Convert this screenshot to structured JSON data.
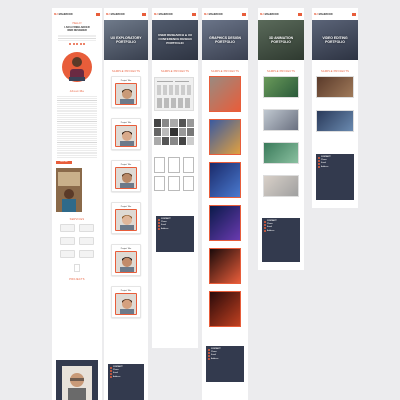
{
  "brand": {
    "logo_prefix": "MJ",
    "logo_text": "MAHMOOD",
    "accent": "#e85d3a",
    "dark": "#333a4e"
  },
  "profile": {
    "line1": "HELLO!",
    "line2": "I AM A FREELANCER",
    "line3": "WEB DESIGNER",
    "about_title": "About Me",
    "hire_label": "HIRE ME",
    "services_title": "SERVICES",
    "projects_title": "PROJECTS",
    "contact_title": "CONTACT ME",
    "contact_lines": [
      "CONTACT ME",
      "mahmood@mail.com",
      "+880 123 456 789",
      "Dhaka, Bangladesh"
    ]
  },
  "columns": [
    {
      "title": "UX EXPLORATORY PORTFOLIO",
      "section": "SAMPLE PROJECTS"
    },
    {
      "title": "USER RESEARCH & UX CONFERENCE DESIGN PORTFOLIO",
      "section": "SAMPLE PROJECTS"
    },
    {
      "title": "GRAPHICS DESIGN PORTFOLIO",
      "section": "SAMPLE PROJECTS"
    },
    {
      "title": "3D ANIMATION PORTFOLIO",
      "section": "SAMPLE PROJECTS"
    },
    {
      "title": "VIDEO EDITING PORTFOLIO",
      "section": "SAMPLE PROJECTS"
    }
  ],
  "card_caption": "Project Title",
  "buttons": {
    "view_more": "View More",
    "back": "Back"
  },
  "contact_card": {
    "title": "CONTACT",
    "lines": [
      "Phone",
      "Email",
      "Address"
    ]
  },
  "icons": [
    "facebook-icon",
    "twitter-icon",
    "linkedin-icon",
    "instagram-icon",
    "dribbble-icon"
  ]
}
